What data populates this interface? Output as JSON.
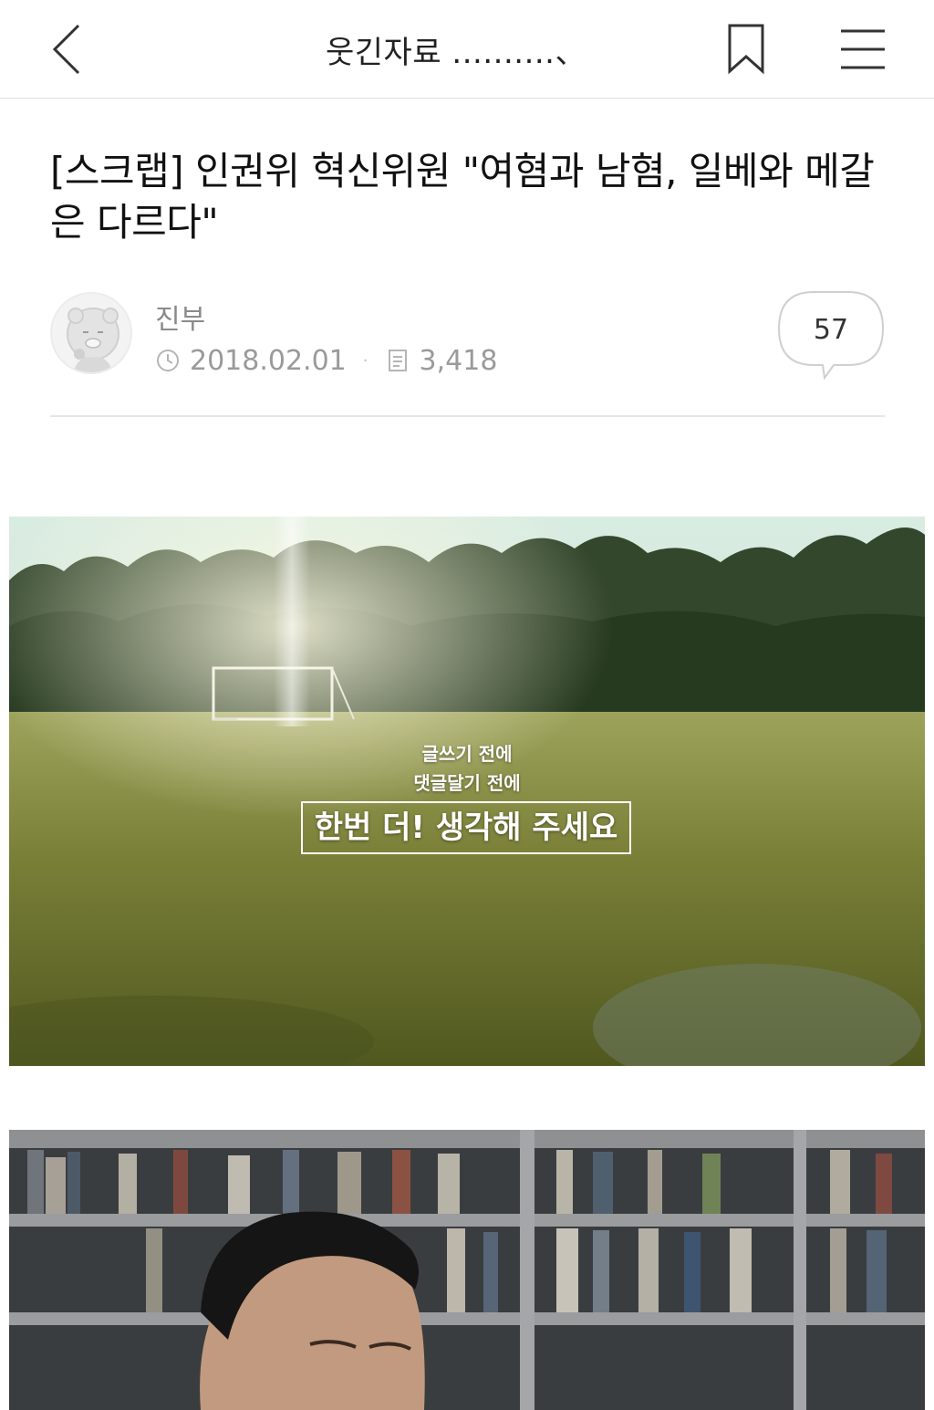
{
  "header": {
    "title": "웃긴자료 ..........、"
  },
  "article": {
    "title": "[스크랩] 인권위 혁신위원 \"여혐과 남혐, 일베와 메갈은 다르다\"",
    "author": "진부",
    "date": "2018.02.01",
    "views": "3,418",
    "comment_count": "57"
  },
  "images": [
    {
      "overlay_line1": "글쓰기 전에",
      "overlay_line2": "댓글달기 전에",
      "overlay_box": "한번 더! 생각해 주세요"
    }
  ],
  "colors": {
    "text": "#222222",
    "meta": "#9a9a9a",
    "divider": "#e5e5e5"
  },
  "icons": [
    "back-icon",
    "bookmark-icon",
    "menu-icon",
    "clock-icon",
    "views-icon",
    "comment-bubble-icon"
  ]
}
